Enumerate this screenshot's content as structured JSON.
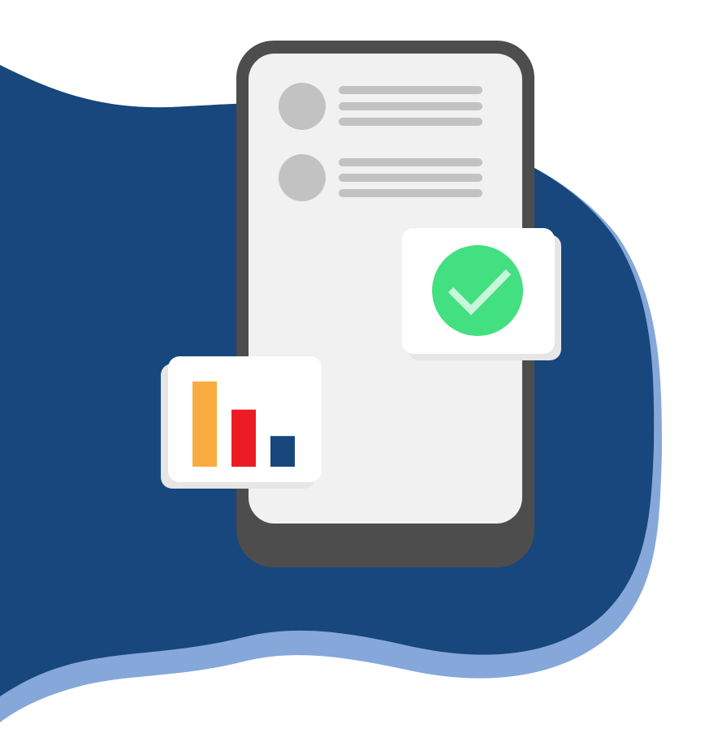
{
  "colors": {
    "page_background": "#ffffff",
    "blob_main": "#17477c",
    "blob_shadow": "#86a7da",
    "phone_body": "#4d4d4d",
    "phone_screen": "#f1f1f1",
    "placeholder_gray": "#c2c2c2",
    "card_background": "#ffffff",
    "card_shadow": "#e6e6e6",
    "check_green": "#42e080",
    "check_mark": "#c8f5db"
  },
  "icons": {
    "check": "check-circle-icon",
    "chart": "bar-chart-icon",
    "avatar": "avatar-placeholder-icon"
  },
  "phone_screen": {
    "list_items": [
      {
        "text_lines": 3
      },
      {
        "text_lines": 3
      }
    ]
  },
  "chart_card": {
    "chart_data": {
      "type": "bar",
      "title": "",
      "xlabel": "",
      "ylabel": "",
      "ylim": [
        0,
        1
      ],
      "values": [
        1.0,
        0.67,
        0.36
      ],
      "colors": [
        "#f9ad40",
        "#eb1c24",
        "#17477c"
      ]
    }
  }
}
